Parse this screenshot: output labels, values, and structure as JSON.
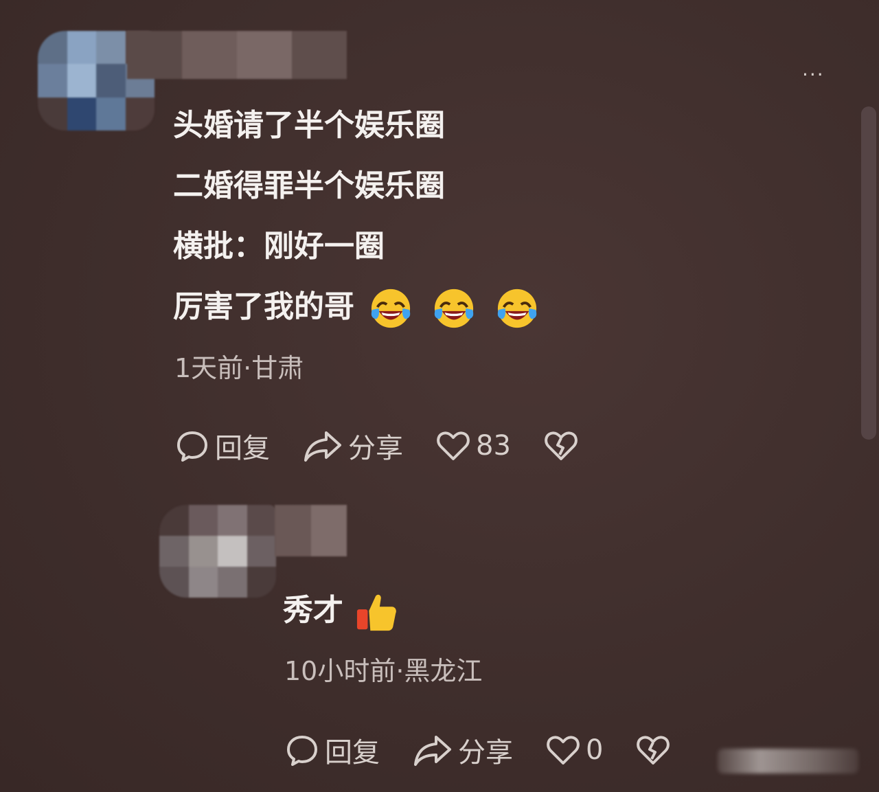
{
  "comments": [
    {
      "lines": [
        "头婚请了半个娱乐圈",
        "二婚得罪半个娱乐圈",
        "横批：刚好一圈",
        "厉害了我的哥"
      ],
      "emoji": [
        "laugh-cry-emoji",
        "laugh-cry-emoji",
        "laugh-cry-emoji"
      ],
      "meta": "1天前·甘肃",
      "actions": {
        "reply": "回复",
        "share": "分享",
        "likes": "83"
      }
    },
    {
      "lines": [
        "秀才"
      ],
      "emoji": [
        "thumbs-up-emoji"
      ],
      "meta": "10小时前·黑龙江",
      "actions": {
        "reply": "回复",
        "share": "分享",
        "likes": "0"
      }
    }
  ],
  "more_menu": "···",
  "colors": {
    "background": "#3f2e2c",
    "text": "#f4f1ef",
    "meta": "#c9bfbc",
    "emoji_yellow": "#f7c42c"
  }
}
